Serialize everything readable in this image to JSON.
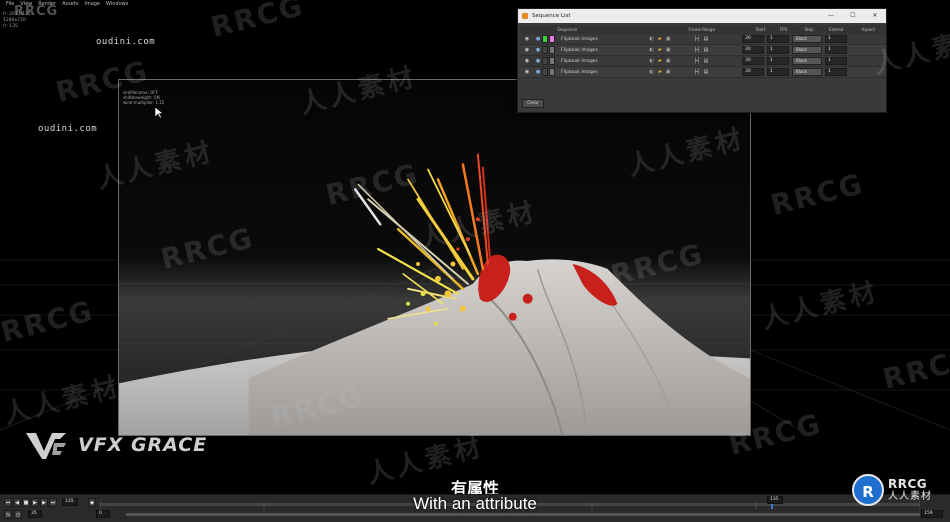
{
  "menu": [
    "File",
    "View",
    "Render",
    "Assets",
    "Image",
    "Windows"
  ],
  "top_info": [
    "fr: 2074/125",
    "1280x720",
    "fr: 135"
  ],
  "watermark_top": "RRCG",
  "url_text_1": "oudini.com",
  "url_text_2": "oudini.com",
  "viewport_info": [
    "simfilename: OFF",
    "shifdexweight: ON",
    "wind:multiplier: 1.15"
  ],
  "sequence_window": {
    "title": "Sequence List",
    "controls": [
      "—",
      "☐",
      "✕"
    ],
    "columns": [
      "Sequence",
      "Frame Range",
      "Start",
      "FPS",
      "Step",
      "Extend",
      "Aspect"
    ],
    "rows": [
      {
        "name": "Flipbook Images",
        "sw1": "#39d13a",
        "sw2": "#e87ae6",
        "fps": "30",
        "step": "1",
        "extend": "Black",
        "aspect": "1"
      },
      {
        "name": "Flipbook Images",
        "sw1": "#444444",
        "sw2": "#777777",
        "fps": "30",
        "step": "1",
        "extend": "Black",
        "aspect": "1"
      },
      {
        "name": "Flipbook Images",
        "sw1": "#444444",
        "sw2": "#777777",
        "fps": "30",
        "step": "1",
        "extend": "Black",
        "aspect": "1"
      },
      {
        "name": "Flipbook Images",
        "sw1": "#444444",
        "sw2": "#777777",
        "fps": "30",
        "step": "1",
        "extend": "Black",
        "aspect": "1"
      }
    ],
    "bottom_button": "Clear"
  },
  "watermarks": {
    "en": "RRCG",
    "cn": "人人素材"
  },
  "brand": {
    "text": "VFX GRACE"
  },
  "subtitle": {
    "cn": "有属性",
    "en": "With an attribute"
  },
  "badge": {
    "icon": "R",
    "en": "RRCG",
    "cn": "人人素材"
  },
  "playbar": {
    "frame_field": "135",
    "current_frame": "135",
    "range_start": "1",
    "range_end": "159",
    "row2_left": "35",
    "row2_field": "0"
  }
}
